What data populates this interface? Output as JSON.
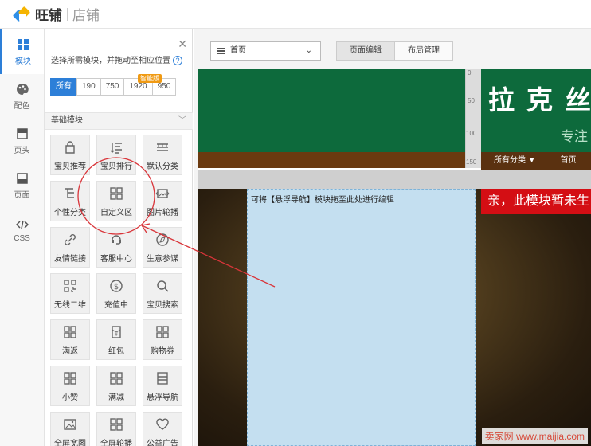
{
  "app": {
    "brand": "旺铺",
    "sub": "店铺"
  },
  "rail": [
    {
      "label": "模块",
      "icon": "grid-icon",
      "active": true
    },
    {
      "label": "配色",
      "icon": "palette-icon",
      "active": false
    },
    {
      "label": "页头",
      "icon": "header-icon",
      "active": false
    },
    {
      "label": "页面",
      "icon": "page-icon",
      "active": false
    },
    {
      "label": "CSS",
      "icon": "code-icon",
      "active": false
    }
  ],
  "panel": {
    "hint": "选择所需模块，并拖动至相应位置",
    "filters": [
      "所有",
      "190",
      "750",
      "1920",
      "950"
    ],
    "badge": "智能版",
    "section": "基础模块",
    "modules": [
      {
        "label": "宝贝推荐",
        "icon": "bag-icon"
      },
      {
        "label": "宝贝排行",
        "icon": "sort-list-icon"
      },
      {
        "label": "默认分类",
        "icon": "category-icon"
      },
      {
        "label": "个性分类",
        "icon": "tree-icon"
      },
      {
        "label": "自定义区",
        "icon": "custom-grid-icon"
      },
      {
        "label": "图片轮播",
        "icon": "carousel-icon"
      },
      {
        "label": "友情链接",
        "icon": "link-icon"
      },
      {
        "label": "客服中心",
        "icon": "service-icon"
      },
      {
        "label": "生意参谋",
        "icon": "compass-icon"
      },
      {
        "label": "无线二维",
        "icon": "qrcode-icon"
      },
      {
        "label": "充值中",
        "icon": "dollar-icon"
      },
      {
        "label": "宝贝搜索",
        "icon": "search-icon"
      },
      {
        "label": "满返",
        "icon": "grid-icon"
      },
      {
        "label": "红包",
        "icon": "red-envelope-icon"
      },
      {
        "label": "购物券",
        "icon": "grid-icon"
      },
      {
        "label": "小赞",
        "icon": "grid-icon"
      },
      {
        "label": "满减",
        "icon": "grid-icon"
      },
      {
        "label": "悬浮导航",
        "icon": "float-nav-icon"
      },
      {
        "label": "全屏宽图",
        "icon": "image-icon"
      },
      {
        "label": "全屏轮播",
        "icon": "grid-icon"
      },
      {
        "label": "公益广告",
        "icon": "heart-icon"
      }
    ]
  },
  "toolbar": {
    "page": "首页",
    "tabs": [
      "页面编辑",
      "布局管理"
    ]
  },
  "canvas": {
    "ruler": [
      "0",
      "50",
      "100",
      "150"
    ],
    "banner_title": "拉克丝",
    "banner_sub": "专注",
    "nav": [
      "所有分类 ▼",
      "首页"
    ],
    "drop_text": "可将【悬浮导航】模块拖至此处进行编辑",
    "promo": "亲，此模块暂未生"
  },
  "watermark": "卖家网  www.maijia.com"
}
